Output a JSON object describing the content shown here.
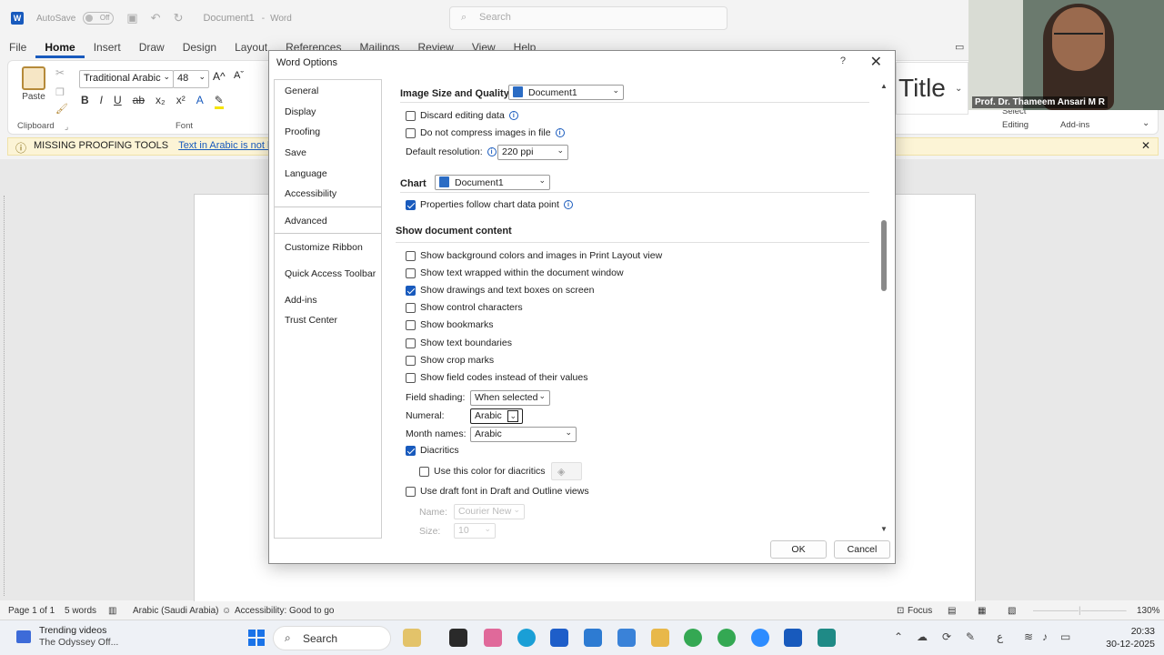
{
  "titlebar": {
    "autosave": "AutoSave",
    "toggle": "Off",
    "doc_title": "Document1",
    "app_name": "Word",
    "search_placeholder": "Search"
  },
  "tabs": [
    "File",
    "Home",
    "Insert",
    "Draw",
    "Design",
    "Layout",
    "References",
    "Mailings",
    "Review",
    "View",
    "Help"
  ],
  "ribbon": {
    "paste": "Paste",
    "font_name": "Traditional Arabic",
    "font_size": "48",
    "clipboard_label": "Clipboard",
    "font_label": "Font",
    "style_preview": "Title",
    "select": "Select",
    "editing": "Editing",
    "addins": "Add-ins"
  },
  "infobar": {
    "title": "MISSING PROOFING TOOLS",
    "message": "Text in Arabic is not being ch"
  },
  "dialog": {
    "title": "Word Options",
    "help": "?",
    "nav": [
      "General",
      "Display",
      "Proofing",
      "Save",
      "Language",
      "Accessibility",
      "Advanced",
      "Customize Ribbon",
      "Quick Access Toolbar",
      "Add-ins",
      "Trust Center"
    ],
    "selected_nav": "Advanced",
    "image_section": {
      "heading": "Image Size and Quality",
      "doc_select": "Document1",
      "discard": "Discard editing data",
      "no_compress": "Do not compress images in file",
      "default_res_label": "Default resolution:",
      "default_res_value": "220 ppi"
    },
    "chart_section": {
      "heading": "Chart",
      "doc_select": "Document1",
      "props_follow": "Properties follow chart data point"
    },
    "show_section": {
      "heading": "Show document content",
      "items": [
        {
          "label": "Show background colors and images in Print Layout view",
          "checked": false
        },
        {
          "label": "Show text wrapped within the document window",
          "checked": false
        },
        {
          "label": "Show drawings and text boxes on screen",
          "checked": true
        },
        {
          "label": "Show control characters",
          "checked": false
        },
        {
          "label": "Show bookmarks",
          "checked": false
        },
        {
          "label": "Show text boundaries",
          "checked": false
        },
        {
          "label": "Show crop marks",
          "checked": false
        },
        {
          "label": "Show field codes instead of their values",
          "checked": false
        }
      ],
      "field_shading_label": "Field shading:",
      "field_shading_value": "When selected",
      "numeral_label": "Numeral:",
      "numeral_value": "Arabic",
      "month_label": "Month names:",
      "month_value": "Arabic",
      "diacritics": "Diacritics",
      "diacritics_color": "Use this color for diacritics",
      "draft_font": "Use draft font in Draft and Outline views",
      "name_label": "Name:",
      "name_value": "Courier New",
      "size_label": "Size:",
      "size_value": "10"
    },
    "ok": "OK",
    "cancel": "Cancel"
  },
  "video": {
    "name": "Prof. Dr. Thameem Ansari M R"
  },
  "statusbar": {
    "page": "Page 1 of 1",
    "words": "5 words",
    "language": "Arabic (Saudi Arabia)",
    "accessibility": "Accessibility: Good to go",
    "focus": "Focus",
    "zoom": "130%"
  },
  "taskbar": {
    "trend_title": "Trending videos",
    "trend_sub": "The Odyssey Off...",
    "search": "Search",
    "time": "20:33",
    "date": "30-12-2025"
  },
  "colors": {
    "accent": "#185abd",
    "info_bg": "#fcf4d6"
  }
}
